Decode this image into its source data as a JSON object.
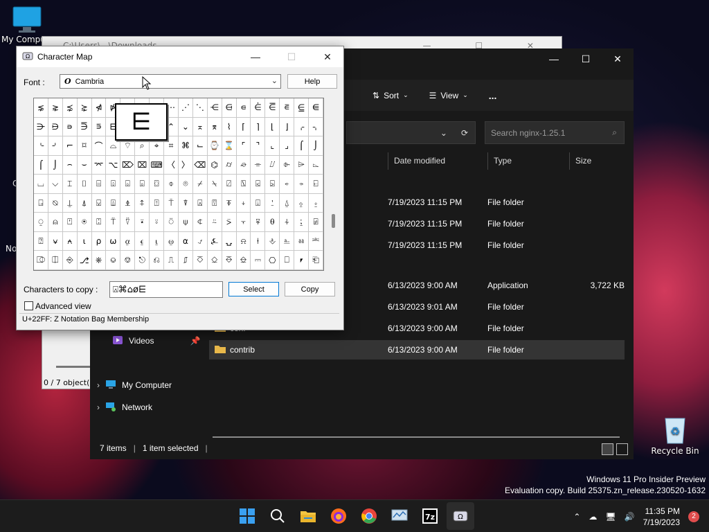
{
  "desktop": {
    "icons": [
      {
        "label": "My Compu",
        "icon": "computer-icon"
      },
      {
        "label": "Recycle Bin",
        "icon": "recycle-bin-icon"
      }
    ],
    "left_labels": [
      "C",
      "No"
    ],
    "watermark": {
      "line1": "Windows 11 Pro Insider Preview",
      "line2": "Evaluation copy. Build 25375.zn_release.230520-1632"
    }
  },
  "explorer_back": {
    "title": "C:\\Users\\...\\Downloads",
    "status": "0 / 7 object(s"
  },
  "explorer": {
    "toolbar": {
      "sort_label": "Sort",
      "view_label": "View",
      "more_label": "..."
    },
    "search": {
      "placeholder": "Search nginx-1.25.1"
    },
    "columns": {
      "date": "Date modified",
      "type": "Type",
      "size": "Size"
    },
    "files": [
      {
        "name": "",
        "date": "7/19/2023 11:15 PM",
        "type": "File folder",
        "size": ""
      },
      {
        "name": "",
        "date": "7/19/2023 11:15 PM",
        "type": "File folder",
        "size": ""
      },
      {
        "name": "",
        "date": "7/19/2023 11:15 PM",
        "type": "File folder",
        "size": ""
      },
      {
        "name": "",
        "date": "6/13/2023 9:00 AM",
        "type": "Application",
        "size": "3,722 KB"
      },
      {
        "name": "",
        "date": "6/13/2023 9:01 AM",
        "type": "File folder",
        "size": ""
      },
      {
        "name": "conf",
        "date": "6/13/2023 9:00 AM",
        "type": "File folder",
        "size": ""
      },
      {
        "name": "contrib",
        "date": "6/13/2023 9:00 AM",
        "type": "File folder",
        "size": ""
      }
    ],
    "nav": {
      "videos": "Videos",
      "my_computer": "My Computer",
      "network": "Network"
    },
    "status": {
      "items": "7 items",
      "selected": "1 item selected"
    }
  },
  "charmap": {
    "title": "Character Map",
    "font_label": "Font :",
    "font_value": "Cambria",
    "help_label": "Help",
    "grid_rows": [
      [
        "⋦",
        "⋧",
        "⋨",
        "⋩",
        "⋪",
        "⋫",
        "⋬",
        "⋭",
        "⋮",
        "⋯",
        "⋰",
        "⋱",
        "⋲",
        "⋳",
        "⋴",
        "⋵",
        "⋶",
        "⋷",
        "⋸",
        "⋹"
      ],
      [
        "⋺",
        "⋻",
        "⋼",
        "⋽",
        "⋾",
        "⋿",
        "⌀",
        "⌁",
        "⌂",
        "⌃",
        "⌄",
        "⌅",
        "⌆",
        "⌇",
        "⌈",
        "⌉",
        "⌊",
        "⌋",
        "⌌",
        "⌍"
      ],
      [
        "⌎",
        "⌏",
        "⌐",
        "⌑",
        "⌒",
        "⌓",
        "⌔",
        "⌕",
        "⌖",
        "⌗",
        "⌘",
        "⌙",
        "⌚",
        "⌛",
        "⌜",
        "⌝",
        "⌞",
        "⌟",
        "⌠",
        "⌡"
      ],
      [
        "⌠",
        "⌡",
        "⌢",
        "⌣",
        "⌤",
        "⌥",
        "⌦",
        "⌧",
        "⌨",
        "〈",
        "〉",
        "⌫",
        "⌬",
        "⌭",
        "⌮",
        "⌯",
        "⌰",
        "⌱",
        "⌲",
        "⌳"
      ],
      [
        "⌴",
        "⌵",
        "⌶",
        "⌷",
        "⌸",
        "⌹",
        "⌺",
        "⌻",
        "⌼",
        "⌽",
        "⌾",
        "⌿",
        "⍀",
        "⍁",
        "⍂",
        "⍃",
        "⍄",
        "⍅",
        "⍆",
        "⍇"
      ],
      [
        "⍈",
        "⍉",
        "⍊",
        "⍋",
        "⍌",
        "⍍",
        "⍎",
        "⍏",
        "⍐",
        "⍑",
        "⍒",
        "⍓",
        "⍔",
        "⍕",
        "⍖",
        "⍗",
        "⍘",
        "⍙",
        "⍚",
        "⍛"
      ],
      [
        "⍜",
        "⍝",
        "⍞",
        "⍟",
        "⍠",
        "⍡",
        "⍢",
        "⍣",
        "⍤",
        "⍥",
        "⍦",
        "⍧",
        "⍨",
        "⍩",
        "⍪",
        "⍫",
        "⍬",
        "⍭",
        "⍮",
        "⍯"
      ],
      [
        "⍰",
        "⍱",
        "⍲",
        "⍳",
        "⍴",
        "⍵",
        "⍶",
        "⍷",
        "⍸",
        "⍹",
        "⍺",
        "⍻",
        "⍼",
        "⍽",
        "⍾",
        "⍿",
        "⎀",
        "⎁",
        "⎂",
        "⎃"
      ],
      [
        "⎄",
        "⎅",
        "⎆",
        "⎇",
        "⎈",
        "⎉",
        "⎊",
        "⎋",
        "⎌",
        "⎍",
        "⎎",
        "⎏",
        "⎐",
        "⎑",
        "⎒",
        "⎓",
        "⎔",
        "⎕",
        "⎖",
        "⎗"
      ]
    ],
    "magnified_char": "⋿",
    "copy_label": "Characters to copy :",
    "copy_value": "⍓⌘⌂ø⋿",
    "select_label": "Select",
    "copy_button": "Copy",
    "advanced_label": "Advanced view",
    "status": "U+22FF: Z Notation Bag Membership"
  },
  "taskbar": {
    "apps": [
      "windows-start-icon",
      "search-icon",
      "file-explorer-icon",
      "firefox-icon",
      "chrome-icon",
      "resource-monitor-icon",
      "7zip-icon",
      "character-map-icon"
    ],
    "time": "11:35 PM",
    "date": "7/19/2023",
    "notifications": "2"
  }
}
